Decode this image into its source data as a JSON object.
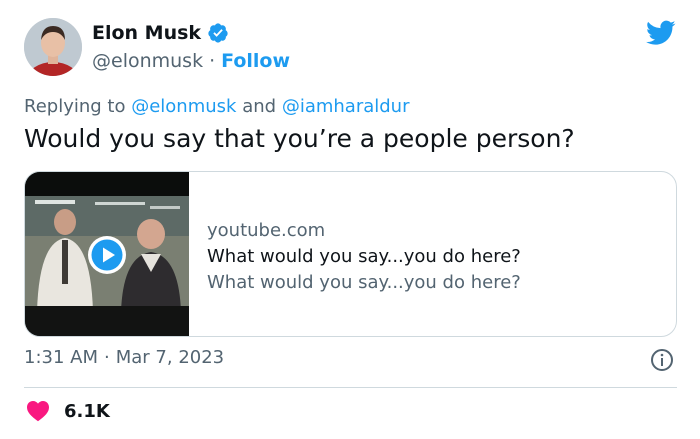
{
  "author": {
    "display_name": "Elon Musk",
    "handle": "@elonmusk",
    "separator": "·",
    "follow_label": "Follow"
  },
  "reply": {
    "prefix": "Replying to",
    "mention_1": "@elonmusk",
    "conjunction": "and",
    "mention_2": "@iamharaldur"
  },
  "tweet": {
    "text": "Would you say that you’re a people person?"
  },
  "card": {
    "domain": "youtube.com",
    "title": "What would you say...you do here?",
    "description": "What would you say...you do here?"
  },
  "meta": {
    "time": "1:31 AM",
    "separator": "·",
    "date": "Mar 7, 2023"
  },
  "engagement": {
    "likes": "6.1K"
  },
  "icons": {
    "verified": "verified-badge-icon",
    "bird": "twitter-bird-icon",
    "play": "play-icon",
    "info": "info-icon",
    "heart": "heart-icon"
  },
  "colors": {
    "accent": "#1d9bf0",
    "secondary_text": "#536471",
    "primary_text": "#0f1419",
    "heart": "#f91880",
    "border": "#cfd9de"
  }
}
